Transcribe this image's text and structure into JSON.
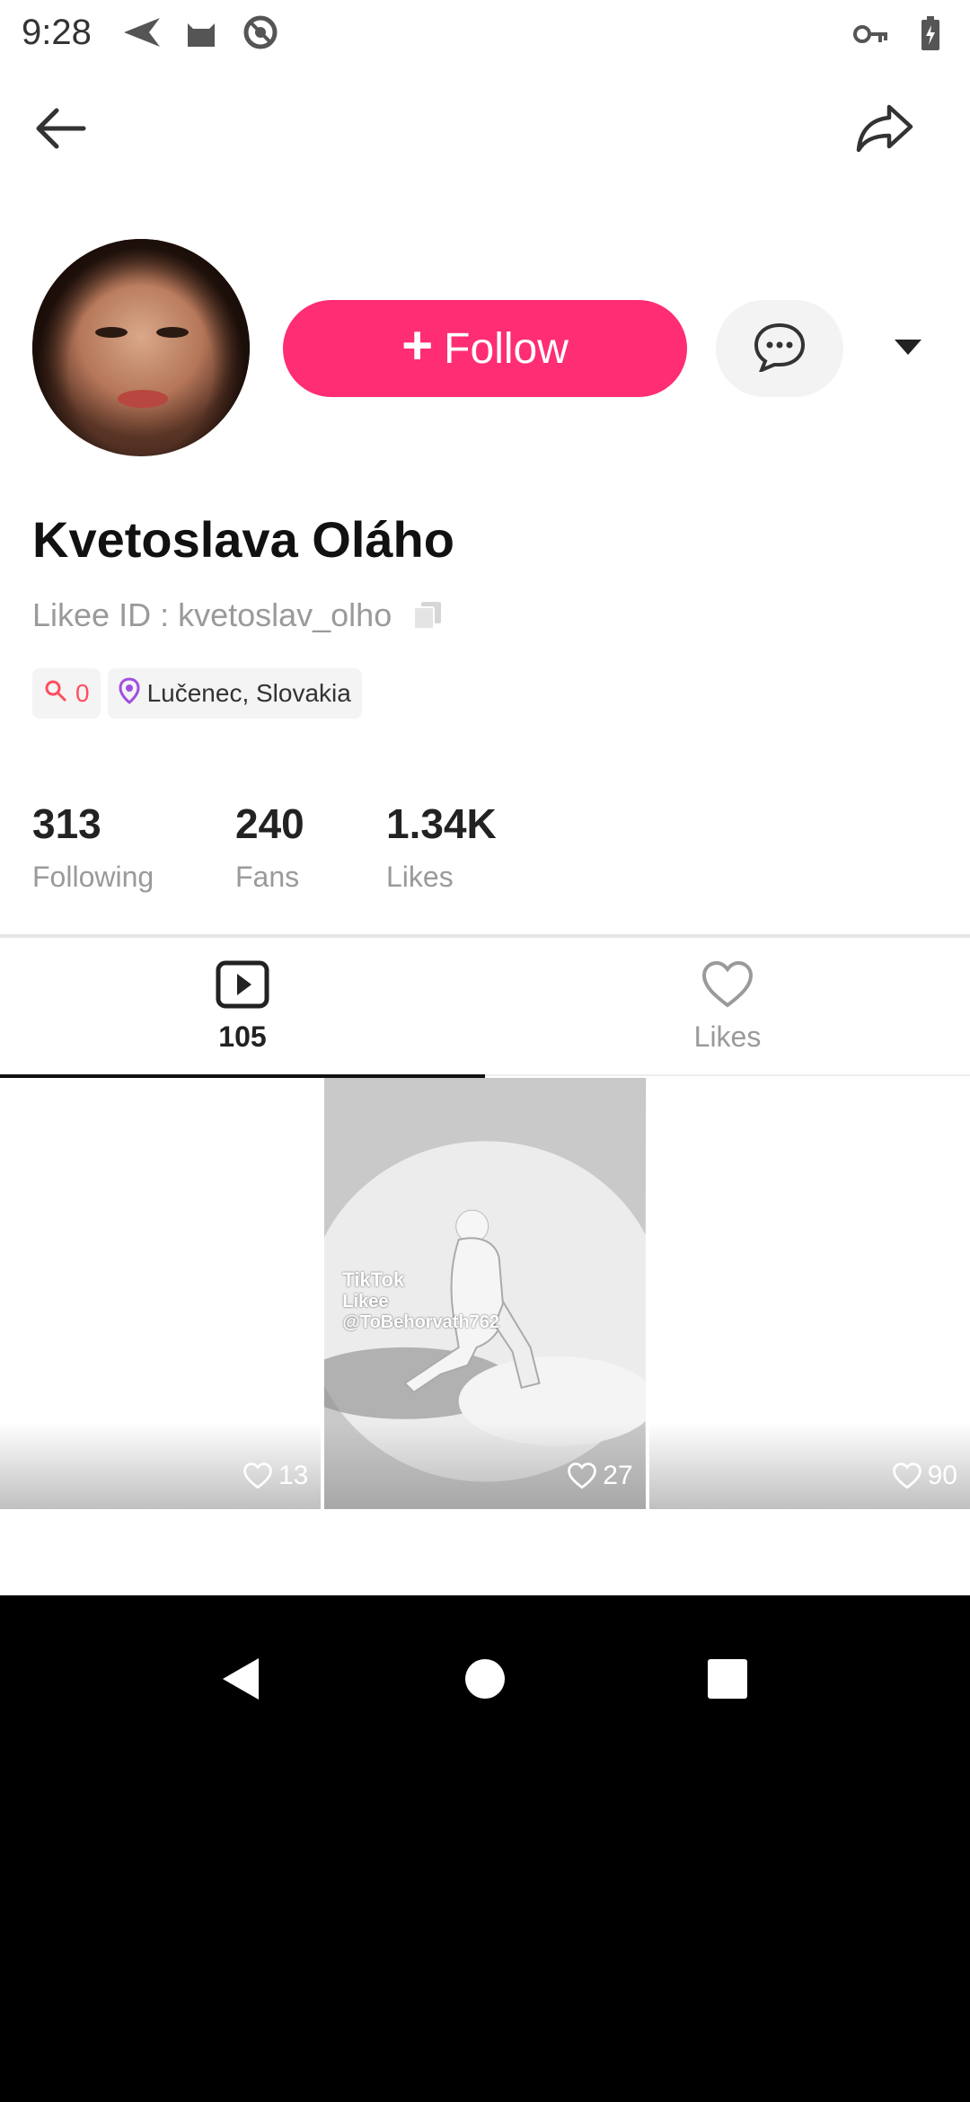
{
  "status_bar": {
    "time": "9:28",
    "left_icons": [
      "send-icon",
      "cat-icon",
      "do-not-disturb-icon"
    ],
    "right_icons": [
      "key-icon",
      "battery-charging-icon"
    ]
  },
  "top_bar": {
    "back_icon": "arrow-left-icon",
    "share_icon": "share-arrow-icon"
  },
  "profile": {
    "follow_label": "Follow",
    "follow_plus": "+",
    "name": "Kvetoslava Oláho",
    "likee_id": "Likee ID : kvetoslav_olho",
    "rank_value": "0",
    "location": "Lučenec, Slovakia",
    "colors": {
      "accent": "#fe2d74",
      "rank": "#ff4d5e",
      "location_pin": "#a050e0"
    }
  },
  "stats": [
    {
      "value": "313",
      "label": "Following"
    },
    {
      "value": "240",
      "label": "Fans"
    },
    {
      "value": "1.34K",
      "label": "Likes"
    }
  ],
  "tabs": [
    {
      "icon": "video-play-icon",
      "label": "105",
      "active": true
    },
    {
      "icon": "heart-outline-icon",
      "label": "Likes",
      "active": false
    }
  ],
  "videos": [
    {
      "likes": "13"
    },
    {
      "likes": "27",
      "watermark_brand": "TikTok",
      "watermark_sub": "Likee",
      "watermark_user": "@ToBehorvath762"
    },
    {
      "likes": "90"
    }
  ],
  "nav_bar": {
    "buttons": [
      "back-triangle-icon",
      "home-circle-icon",
      "recents-square-icon"
    ]
  }
}
